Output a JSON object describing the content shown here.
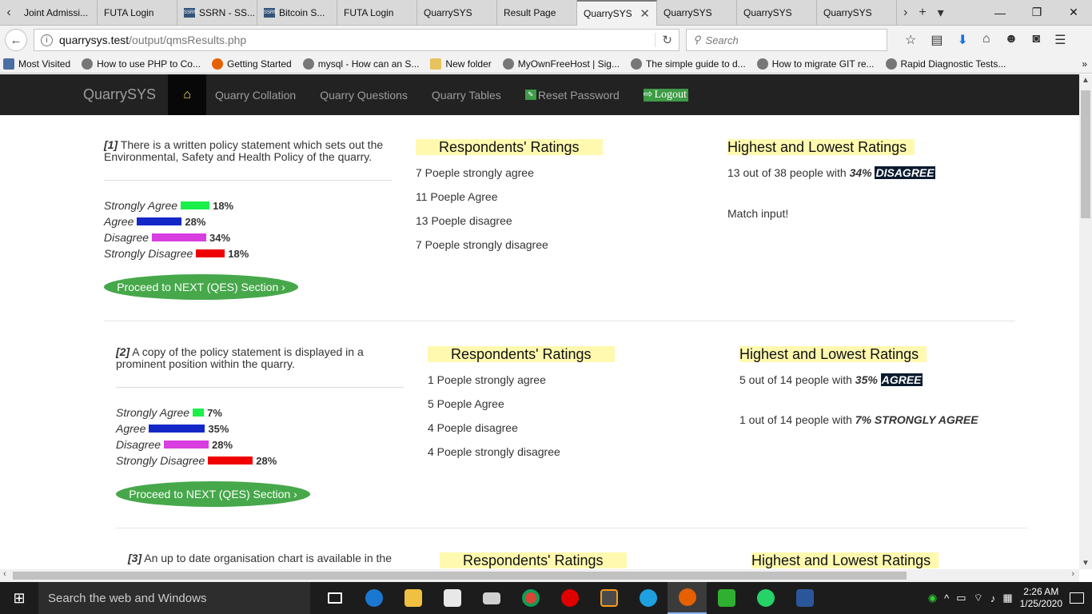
{
  "browser": {
    "tabs": [
      {
        "label": "Joint Admissi...",
        "active": false
      },
      {
        "label": "FUTA Login",
        "active": false
      },
      {
        "label": "SSRN - SS...",
        "active": false
      },
      {
        "label": "Bitcoin S...",
        "active": false
      },
      {
        "label": "FUTA Login",
        "active": false
      },
      {
        "label": "QuarrySYS",
        "active": false
      },
      {
        "label": "Result Page",
        "active": false
      },
      {
        "label": "QuarrySYS",
        "active": true
      },
      {
        "label": "QuarrySYS",
        "active": false
      },
      {
        "label": "QuarrySYS",
        "active": false
      },
      {
        "label": "QuarrySYS",
        "active": false
      }
    ],
    "favicon_text": "SSRN",
    "url_host": "quarrysys.test",
    "url_path": "/output/qmsResults.php",
    "search_placeholder": "Search",
    "bookmarks": [
      {
        "label": "Most Visited",
        "icon": "gear-icon"
      },
      {
        "label": "How to use PHP to Co...",
        "icon": "globe-icon"
      },
      {
        "label": "Getting Started",
        "icon": "firefox-icon"
      },
      {
        "label": "mysql - How can an S...",
        "icon": "globe-icon"
      },
      {
        "label": "New folder",
        "icon": "folder-icon"
      },
      {
        "label": "MyOwnFreeHost | Sig...",
        "icon": "globe-icon"
      },
      {
        "label": "The simple guide to d...",
        "icon": "globe-icon"
      },
      {
        "label": "How to migrate GIT re...",
        "icon": "globe-icon"
      },
      {
        "label": "Rapid Diagnostic Tests...",
        "icon": "globe-icon"
      }
    ]
  },
  "site": {
    "brand": "QuarrySYS",
    "nav": {
      "collation": "Quarry Collation",
      "questions": "Quarry Questions",
      "tables": "Quarry Tables",
      "reset": "Reset Password",
      "logout": "Logout"
    }
  },
  "common": {
    "proceed_label": "Proceed to NEXT (QES) Section ›",
    "ratings_heading": "Respondents' Ratings",
    "highlow_heading": "Highest and Lowest Ratings",
    "labels": {
      "sa": "Strongly Agree",
      "a": "Agree",
      "d": "Disagree",
      "sd": "Strongly Disagree"
    },
    "colors": {
      "sa": "#19f04a",
      "a": "#1428c8",
      "d": "#d83ee0",
      "sd": "#f00000",
      "heading_bg": "#fff9b0",
      "button": "#46a84a"
    }
  },
  "questions": [
    {
      "num": "[1]",
      "text": "There is a written policy statement which sets out the Environmental, Safety and Health Policy of the quarry.",
      "pct": {
        "sa": "18%",
        "a": "28%",
        "d": "34%",
        "sd": "18%"
      },
      "pct_values": {
        "sa": 18,
        "a": 28,
        "d": 34,
        "sd": 18
      },
      "ratings": [
        "7 Poeple strongly agree",
        "11 Poeple Agree",
        "13 Poeple disagree",
        "7 Poeple strongly disagree"
      ],
      "highlow": {
        "line1_prefix": "13 out of 38 people with",
        "line1_pct": "34%",
        "line1_tag": "DISAGREE",
        "line2": "Match input!"
      }
    },
    {
      "num": "[2]",
      "text": "A copy of the policy statement is displayed in a prominent position within the quarry.",
      "pct": {
        "sa": "7%",
        "a": "35%",
        "d": "28%",
        "sd": "28%"
      },
      "pct_values": {
        "sa": 7,
        "a": 35,
        "d": 28,
        "sd": 28
      },
      "ratings": [
        "1 Poeple strongly agree",
        "5 Poeple Agree",
        "4 Poeple disagree",
        "4 Poeple strongly disagree"
      ],
      "highlow": {
        "line1_prefix": "5 out of 14 people with",
        "line1_pct": "35%",
        "line1_tag": "AGREE",
        "line2_prefix": "1 out of 14 people with",
        "line2_bold": "7% STRONGLY AGREE"
      }
    },
    {
      "num": "[3]",
      "text": "An up to date organisation chart is available in the"
    }
  ],
  "taskbar": {
    "search_placeholder": "Search the web and Windows",
    "time": "2:26 AM",
    "date": "1/25/2020"
  }
}
